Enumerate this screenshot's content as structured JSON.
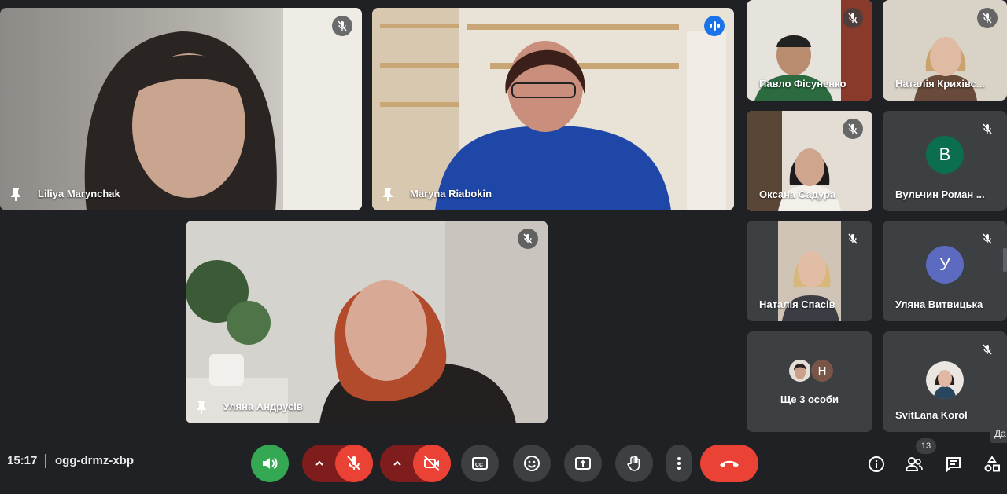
{
  "participants": {
    "liliya": {
      "name": "Liliya Marynchak"
    },
    "maryna": {
      "name": "Maryna Riabokin"
    },
    "uliana_a": {
      "name": "Уляна Андрусів"
    },
    "pavlo": {
      "name": "Павло Фісуненко"
    },
    "natalia_k": {
      "name": "Наталія Крихівс..."
    },
    "oksana": {
      "name": "Оксана Садура"
    },
    "vulchyn": {
      "name": "Вульчин Роман ...",
      "initial": "В",
      "color": "#0b6e4f"
    },
    "natalia_s": {
      "name": "Наталія Спасів"
    },
    "uliana_v": {
      "name": "Уляна Витвицька",
      "initial": "У",
      "color": "#5c6bc0"
    },
    "more": {
      "label": "Ще 3 особи",
      "initial": "Н",
      "color": "#795548"
    },
    "svitlana": {
      "name": "SvitLana Korol"
    }
  },
  "bottom_bar": {
    "time": "15:17",
    "meeting_code": "ogg-drmz-xbp",
    "people_count": "13",
    "tooltip": "Да"
  },
  "colors": {
    "background": "#202124",
    "control": "#3c4043",
    "danger": "#ea4335",
    "accent": "#1a73e8"
  }
}
